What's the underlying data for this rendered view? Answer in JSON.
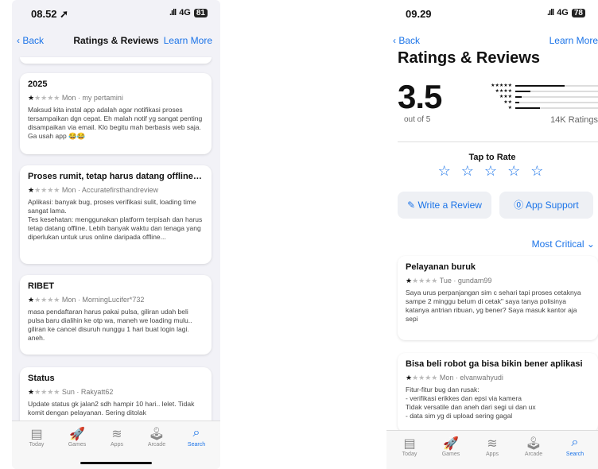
{
  "left": {
    "status": {
      "time": "08.52 ➚",
      "signal": ".ıll",
      "network": "4G",
      "battery": "81"
    },
    "nav": {
      "back": "Back",
      "title": "Ratings & Reviews",
      "learn": "Learn More"
    },
    "reviews": [
      {
        "title": "2025",
        "rating": 1,
        "date": "Mon",
        "author": "my pertamini",
        "body": "Maksud kita instal app adalah agar notifikasi proses tersampaikan dgn cepat. Eh malah notif yg sangat penting disampaikan via email. Klo begitu mah berbasis web saja. Ga usah app 😂😂"
      },
      {
        "title": "Proses rumit, tetap harus datang offline, ti...",
        "rating": 1,
        "date": "Mon",
        "author": "Accuratefirsthandreview",
        "body": "Aplikasi: banyak bug, proses verifikasi sulit, loading time sangat lama.\nTes kesehatan: menggunakan platform terpisah dan harus tetap datang offline. Lebih banyak waktu dan tenaga yang diperlukan untuk urus online daripada offline..."
      },
      {
        "title": "RIBET",
        "rating": 1,
        "date": "Mon",
        "author": "MorningLucifer*732",
        "body": "masa pendaftaran harus pakai pulsa, giliran udah beli pulsa baru dialihin ke otp wa, maneh we loading mulu.. giliran ke cancel disuruh nunggu 1 hari buat login lagi. aneh."
      },
      {
        "title": "Status",
        "rating": 1,
        "date": "Sun",
        "author": "Rakyatt62",
        "body": "Update status gk jalan2 sdh hampir 10 hari.. lelet. Tidak komit dengan pelayanan. Sering ditolak"
      }
    ],
    "tabs": [
      "Today",
      "Games",
      "Apps",
      "Arcade",
      "Search"
    ]
  },
  "right": {
    "status": {
      "time": "09.29",
      "signal": ".ıll",
      "network": "4G",
      "battery": "78"
    },
    "nav": {
      "back": "Back",
      "learn": "Learn More"
    },
    "title": "Ratings & Reviews",
    "average": "3.5",
    "out_of": "out of 5",
    "ratings_count": "14K Ratings",
    "histogram": [
      {
        "stars": "★★★★★",
        "fraction": 0.6
      },
      {
        "stars": "★★★★",
        "fraction": 0.18
      },
      {
        "stars": "★★★",
        "fraction": 0.08
      },
      {
        "stars": "★★",
        "fraction": 0.05
      },
      {
        "stars": "★",
        "fraction": 0.3
      }
    ],
    "tap_label": "Tap to Rate",
    "tap_stars": "☆ ☆ ☆ ☆ ☆",
    "write_review": "✎ Write a Review",
    "app_support": "⓪ App Support",
    "sort": "Most Critical ⌄",
    "reviews": [
      {
        "title": "Pelayanan buruk",
        "rating": 1,
        "date": "Tue",
        "author": "gundam99",
        "body": "Saya urus perpanjangan sim c sehari tapi proses cetaknya sampe 2 minggu belum di cetak\" saya tanya polisinya katanya antrian ribuan, yg bener? Saya masuk kantor aja sepi"
      },
      {
        "title": "Bisa beli robot ga bisa bikin bener aplikasi",
        "rating": 1,
        "date": "Mon",
        "author": "elvanwahyudi",
        "body": "Fitur-fitur bug dan rusak:\n- verifikasi erikkes dan epsi via kamera\nTidak versatile dan aneh dari segi ui dan ux\n- data sim yg di upload sering gagal"
      }
    ],
    "tabs": [
      "Today",
      "Games",
      "Apps",
      "Arcade",
      "Search"
    ]
  },
  "icons": {
    "today": "today-icon",
    "games": "rocket-icon",
    "apps": "layers-icon",
    "arcade": "joystick-icon",
    "search": "search-icon"
  }
}
